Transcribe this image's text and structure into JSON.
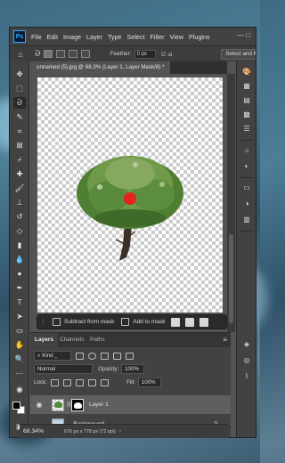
{
  "app": {
    "logo_text": "Ps",
    "window_controls": "— □"
  },
  "menubar": {
    "items": [
      "File",
      "Edit",
      "Image",
      "Layer",
      "Type",
      "Select",
      "Filter",
      "View",
      "Plugins"
    ]
  },
  "options": {
    "feather_label": "Feather:",
    "feather_value": "0 px",
    "antialias": "☑ al",
    "select_and_mask": "Select and M"
  },
  "document": {
    "tab_title": "unnamed (5).jpg @ 68.3% (Layer 1, Layer Mask/8) *"
  },
  "mask_bar": {
    "subtract_label": "Subtract from mask",
    "add_label": "Add to mask"
  },
  "layers_panel": {
    "tabs": [
      "Layers",
      "Channels",
      "Paths"
    ],
    "filter_label": "Kind",
    "blend_mode": "Normal",
    "opacity_label": "Opacity:",
    "opacity_value": "100%",
    "lock_label": "Lock:",
    "fill_label": "Fill:",
    "fill_value": "100%",
    "layers": [
      {
        "name": "Layer 1",
        "visible": true,
        "selected": true
      },
      {
        "name": "Background",
        "visible": false,
        "selected": false
      }
    ],
    "footer_icons": [
      "link-icon",
      "fx-icon",
      "adjustment-icon",
      "mask-icon",
      "new-group-icon",
      "new-layer-icon",
      "delete-icon"
    ]
  },
  "status_bar": {
    "zoom": "68.34%",
    "doc_info": "676 px x 778 px (72 ppi)"
  },
  "tools": [
    "move-icon",
    "artboard-icon",
    "lasso-icon",
    "quick-select-icon",
    "crop-icon",
    "frame-icon",
    "eyedropper-icon",
    "healing-icon",
    "brush-icon",
    "clone-stamp-icon",
    "history-brush-icon",
    "eraser-icon",
    "gradient-icon",
    "blur-icon",
    "dodge-icon",
    "pen-icon",
    "type-icon",
    "path-select-icon",
    "rectangle-icon",
    "hand-icon",
    "zoom-icon",
    "more-tools-icon"
  ],
  "colors": {
    "accent": "#31a8ff",
    "ui_bg": "#535353",
    "panel_bg": "#424242",
    "selection_dot": "#e5231d"
  }
}
